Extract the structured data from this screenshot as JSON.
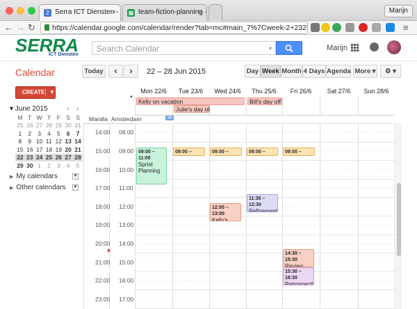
{
  "browser": {
    "tabs": [
      {
        "label": "Serra ICT Diensten - Calen",
        "icon": "calendar-tab-icon"
      },
      {
        "label": "team-fiction-planning - Go",
        "icon": "sheets-tab-icon"
      }
    ],
    "user_button": "Marijn",
    "url": "https://calendar.google.com/calendar/render?tab=mc#main_7%7Cweek-2+23254+23..."
  },
  "header": {
    "logo_main": "SERRA",
    "logo_sub": "ICT Diensten",
    "search_placeholder": "Search Calendar",
    "username": "Marijn"
  },
  "toolbar": {
    "title": "Calendar",
    "today": "Today",
    "prev": "‹",
    "next": "›",
    "date_range": "22 – 28 Jun 2015",
    "views": [
      "Day",
      "Week",
      "Month",
      "4 Days",
      "Agenda"
    ],
    "selected_view": "Week",
    "more": "More ▾",
    "settings": "⚙ ▾"
  },
  "sidebar": {
    "create": "CREATE",
    "month_label": "▾ June 2015",
    "mini_cal_headers": [
      "M",
      "T",
      "W",
      "T",
      "F",
      "S",
      "S"
    ],
    "mini_cal_rows": [
      [
        "25",
        "26",
        "27",
        "28",
        "29",
        "30",
        "31"
      ],
      [
        "1",
        "2",
        "3",
        "4",
        "5",
        "6",
        "7"
      ],
      [
        "8",
        "9",
        "10",
        "11",
        "12",
        "13",
        "14"
      ],
      [
        "15",
        "16",
        "17",
        "18",
        "19",
        "20",
        "21"
      ],
      [
        "22",
        "23",
        "24",
        "25",
        "26",
        "27",
        "28"
      ],
      [
        "29",
        "30",
        "1",
        "2",
        "3",
        "4",
        "5"
      ]
    ],
    "my_calendars": "My calendars",
    "other_calendars": "Other calendars"
  },
  "grid": {
    "days": [
      "Mon 22/6",
      "Tue 23/6",
      "Wed 24/6",
      "Thu 25/6",
      "Fri 26/6",
      "Sat 27/6",
      "Sun 28/6"
    ],
    "tz_left": "Manilla",
    "tz_right": "Amsterdam",
    "tz_badge": "36",
    "manila_hours": [
      "14:00",
      "15:00",
      "16:00",
      "17:00",
      "18:00",
      "19:00",
      "20:00",
      "21:00",
      "22:00",
      "23:00"
    ],
    "amsterdam_hours": [
      "08:00",
      "09:00",
      "10:00",
      "11:00",
      "12:00",
      "13:00",
      "14:00",
      "15:00",
      "16:00",
      "17:00"
    ],
    "all_day_events": [
      {
        "title": "Kelly on vacation",
        "color": "#f8c6c0"
      },
      {
        "title": "Julie's day off",
        "color": "#f8c6c0"
      },
      {
        "title": "Bill's day off",
        "color": "#f8c6c0"
      }
    ],
    "events": [
      {
        "time": "09:00 – 11:00",
        "title": "Sprint Planning",
        "color": "#c9f2dc"
      },
      {
        "time": "09:00 – Daily",
        "title": "",
        "color": "#fde4b3"
      },
      {
        "time": "09:00 – Daily",
        "title": "",
        "color": "#fde4b3"
      },
      {
        "time": "09:00 – Daily",
        "title": "",
        "color": "#fde4b3"
      },
      {
        "time": "09:00 – Daily",
        "title": "",
        "color": "#fde4b3"
      },
      {
        "time": "12:00 – 13:00",
        "title": "Kelly's back!",
        "color": "#f9d0c4"
      },
      {
        "time": "11:30 – 12:30",
        "title": "Refinement",
        "color": "#dcdcf8"
      },
      {
        "time": "14:30 – 15:30",
        "title": "Review",
        "color": "#f9d0c4"
      },
      {
        "time": "15:30 – 16:30",
        "title": "Retrospective",
        "color": "#ecd6f2"
      }
    ]
  }
}
